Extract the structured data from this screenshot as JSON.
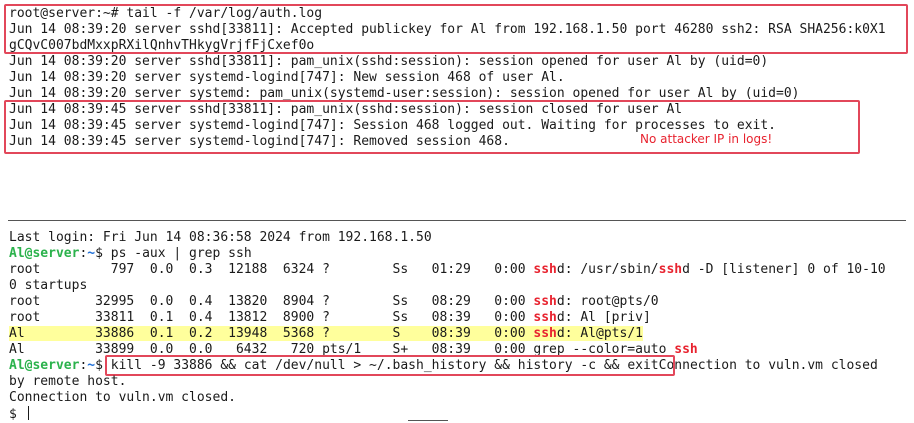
{
  "top_terminal": {
    "lines": [
      "root@server:~# tail -f /var/log/auth.log",
      "Jun 14 08:39:20 server sshd[33811]: Accepted publickey for Al from 192.168.1.50 port 46280 ssh2: RSA SHA256:k0X1",
      "gCQvC007bdMxxpRXilQnhvTHkygVrjfFjCxef0o",
      "Jun 14 08:39:20 server sshd[33811]: pam_unix(sshd:session): session opened for user Al by (uid=0)",
      "Jun 14 08:39:20 server systemd-logind[747]: New session 468 of user Al.",
      "Jun 14 08:39:20 server systemd: pam_unix(systemd-user:session): session opened for user Al by (uid=0)",
      "Jun 14 08:39:45 server sshd[33811]: pam_unix(sshd:session): session closed for user Al",
      "Jun 14 08:39:45 server systemd-logind[747]: Session 468 logged out. Waiting for processes to exit.",
      "Jun 14 08:39:45 server systemd-logind[747]: Removed session 468."
    ],
    "annotation": "No attacker IP in logs!"
  },
  "bottom_terminal": {
    "last_login": "Last login: Fri Jun 14 08:36:58 2024 from 192.168.1.50",
    "prompt_user": "Al@server",
    "prompt_sep": ":",
    "prompt_path": "~",
    "prompt_symbol": "$ ",
    "cmd1": "ps -aux | grep ssh",
    "ps_rows": [
      {
        "pre": "root         797  0.0  0.3  12188  6324 ?        Ss   01:29   0:00 ",
        "hl": "ssh",
        "mid": "d: /usr/sbin/",
        "hl2": "ssh",
        "post": "d -D [listener] 0 of 10-10"
      },
      {
        "pre": "0 startups",
        "hl": "",
        "mid": "",
        "hl2": "",
        "post": ""
      },
      {
        "pre": "root       32995  0.0  0.4  13820  8904 ?        Ss   08:29   0:00 ",
        "hl": "ssh",
        "mid": "d: root@pts/0",
        "hl2": "",
        "post": ""
      },
      {
        "pre": "root       33811  0.1  0.4  13812  8900 ?        Ss   08:39   0:00 ",
        "hl": "ssh",
        "mid": "d: Al [priv]",
        "hl2": "",
        "post": ""
      },
      {
        "pre": "Al         33886  0.1  0.2  13948  5368 ?        S    08:39   0:00 ",
        "hl": "ssh",
        "mid": "d: Al@pts/1",
        "hl2": "",
        "post": ""
      },
      {
        "pre": "Al         33899  0.0  0.0   6432   720 pts/1    S+   08:39   0:00 grep --color=auto ",
        "hl": "ssh",
        "mid": "",
        "hl2": "",
        "post": ""
      }
    ],
    "cmd2": "kill -9 33886 && cat /dev/null > ~/.bash_history && history -c && exit",
    "cmd2_tail": "Connection to vuln.vm closed",
    "wrap_line": "by remote host.",
    "closed_line": "Connection to vuln.vm closed.",
    "final_prompt": "$ "
  },
  "colors": {
    "prompt_user": "#2bb24c",
    "prompt_path": "#1e6fd9",
    "highlight_text": "#e8232f",
    "highlight_row": "#ffff9c",
    "annotation_box": "#e2475a"
  }
}
